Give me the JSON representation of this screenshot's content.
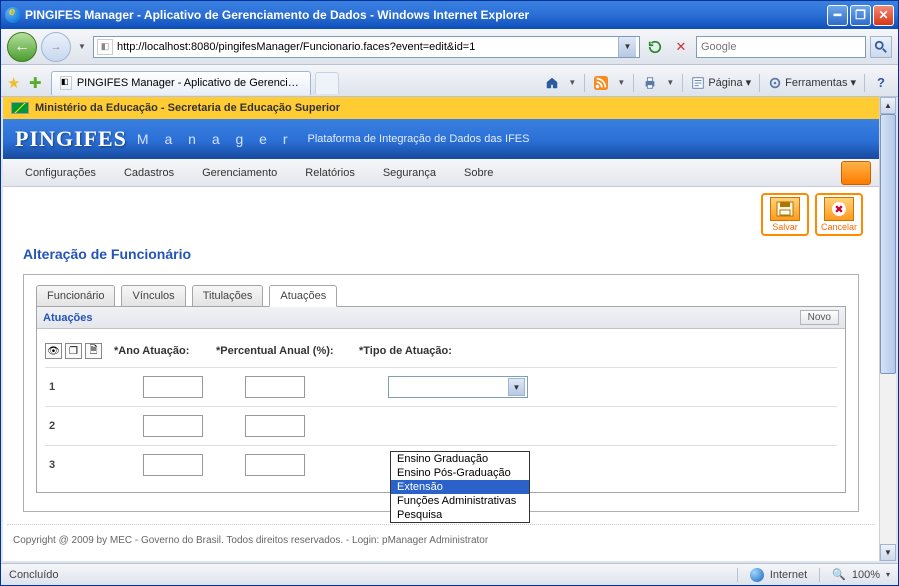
{
  "window": {
    "title": "PINGIFES Manager - Aplicativo de Gerenciamento de Dados - Windows Internet Explorer"
  },
  "address": {
    "url": "http://localhost:8080/pingifesManager/Funcionario.faces?event=edit&id=1"
  },
  "search": {
    "placeholder": "Google"
  },
  "pagetab": {
    "title": "PINGIFES Manager - Aplicativo de Gerenciamento de ..."
  },
  "ie_toolbar": {
    "pagina": "Página",
    "ferramentas": "Ferramentas"
  },
  "gov_bar": "Ministério da Educação - Secretaria de Educação Superior",
  "app_header": {
    "brand": "PINGIFES",
    "mgr": "M a n a g e r",
    "subtitle": "Plataforma de Integração de Dados das IFES"
  },
  "menu": {
    "configuracoes": "Configurações",
    "cadastros": "Cadastros",
    "gerenciamento": "Gerenciamento",
    "relatorios": "Relatórios",
    "seguranca": "Segurança",
    "sobre": "Sobre"
  },
  "actions": {
    "salvar": "Salvar",
    "cancelar": "Cancelar"
  },
  "page_title": "Alteração de Funcionário",
  "tabs": {
    "funcionario": "Funcionário",
    "vinculos": "Vínculos",
    "titulacoes": "Titulações",
    "atuacoes": "Atuações"
  },
  "panel": {
    "title": "Atuações",
    "novo": "Novo"
  },
  "columns": {
    "ano": "*Ano Atuação:",
    "perc": "*Percentual Anual (%):",
    "tipo": "*Tipo de Atuação:"
  },
  "rows": {
    "r1": "1",
    "r2": "2",
    "r3": "3"
  },
  "dropdown_options": {
    "o1": "Ensino Graduação",
    "o2": "Ensino Pós-Graduação",
    "o3": "Extensão",
    "o4": "Funções Administrativas",
    "o5": "Pesquisa"
  },
  "footer": "Copyright @ 2009 by MEC - Governo do Brasil. Todos direitos reservados. - Login: pManager Administrator",
  "status": {
    "left": "Concluído",
    "zone": "Internet",
    "zoom": "100%"
  }
}
